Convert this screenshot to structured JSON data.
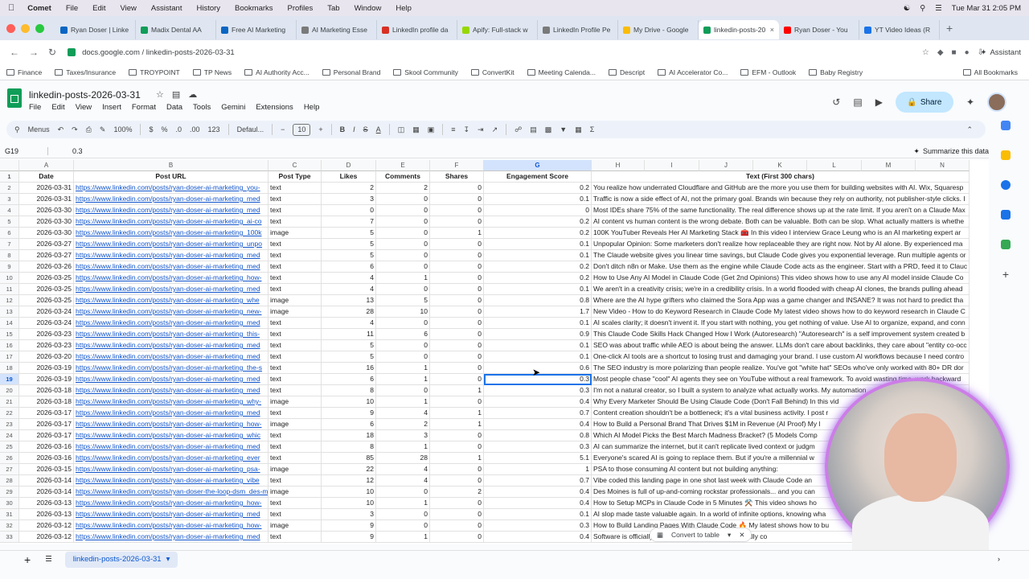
{
  "menubar": {
    "app": "Comet",
    "items": [
      "File",
      "Edit",
      "View",
      "Assistant",
      "History",
      "Bookmarks",
      "Profiles",
      "Tab",
      "Window",
      "Help"
    ],
    "datetime": "Tue Mar 31  2:05 PM"
  },
  "tabs": [
    {
      "label": "Ryan Doser | Linke",
      "color": "#0a66c2"
    },
    {
      "label": "Madix Dental AA",
      "color": "#0f9d58"
    },
    {
      "label": "Free AI Marketing",
      "color": "#0a66c2"
    },
    {
      "label": "AI Marketing Esse",
      "color": "#7a7a7a"
    },
    {
      "label": "LinkedIn profile da",
      "color": "#d93025"
    },
    {
      "label": "Apify: Full-stack w",
      "color": "#97d700"
    },
    {
      "label": "LinkedIn Profile Pe",
      "color": "#7a7a7a"
    },
    {
      "label": "My Drive - Google",
      "color": "#fbbc04"
    },
    {
      "label": "linkedin-posts-20",
      "color": "#0f9d58",
      "active": true
    },
    {
      "label": "Ryan Doser - You",
      "color": "#ff0000"
    },
    {
      "label": "YT Video Ideas (R",
      "color": "#1a73e8"
    }
  ],
  "address": {
    "url": "docs.google.com / linkedin-posts-2026-03-31",
    "assistant": "Assistant"
  },
  "bookmarks": [
    "Finance",
    "Taxes/Insurance",
    "TROYPOINT",
    "TP News",
    "AI Authority Acc...",
    "Personal Brand",
    "Skool Community",
    "ConvertKit",
    "Meeting Calenda...",
    "Descript",
    "AI Accelerator Co...",
    "EFM - Outlook",
    "Baby Registry"
  ],
  "all_bookmarks": "All Bookmarks",
  "sheet": {
    "title": "linkedin-posts-2026-03-31",
    "menus": [
      "File",
      "Edit",
      "View",
      "Insert",
      "Format",
      "Data",
      "Tools",
      "Gemini",
      "Extensions",
      "Help"
    ],
    "share": "Share",
    "toolbar": {
      "menus": "Menus",
      "zoom": "100%",
      "currency": "$",
      "percent": "%",
      "dec1": ".0",
      "dec2": ".00",
      "fmt": "123",
      "font": "Defaul...",
      "size": "10"
    },
    "namebox": "G19",
    "formula": "0.3",
    "summarize": "Summarize this data",
    "columns": [
      "A",
      "B",
      "C",
      "D",
      "E",
      "F",
      "G",
      "H",
      "I",
      "J",
      "K",
      "L",
      "M",
      "N"
    ],
    "headers": [
      "Date",
      "Post URL",
      "Post Type",
      "Likes",
      "Comments",
      "Shares",
      "Engagement Score",
      "Text (First 300 chars)"
    ],
    "rows": [
      [
        "2026-03-31",
        "https://www.linkedin.com/posts/ryan-doser-ai-marketing_you-",
        "text",
        "2",
        "2",
        "0",
        "0.2",
        "You realize how underrated Cloudflare and GitHub are the more you use them for building websites with AI.  Wix, Squaresp"
      ],
      [
        "2026-03-31",
        "https://www.linkedin.com/posts/ryan-doser-ai-marketing_med",
        "text",
        "3",
        "0",
        "0",
        "0.1",
        "Traffic is now a side effect of AI, not the primary goal. Brands win because they rely on authority, not publisher-style clicks. I"
      ],
      [
        "2026-03-30",
        "https://www.linkedin.com/posts/ryan-doser-ai-marketing_med",
        "text",
        "0",
        "0",
        "0",
        "0",
        "Most IDEs share 75% of the same functionality. The real difference shows up at the rate limit. If you aren't on a Claude Max"
      ],
      [
        "2026-03-30",
        "https://www.linkedin.com/posts/ryan-doser-ai-marketing_ai-co",
        "text",
        "7",
        "0",
        "0",
        "0.2",
        "AI content vs human content is the wrong debate.  Both can be valuable. Both can be slop.  What actually matters is whethe"
      ],
      [
        "2026-03-30",
        "https://www.linkedin.com/posts/ryan-doser-ai-marketing_100k",
        "image",
        "5",
        "0",
        "1",
        "0.2",
        "100K YouTuber Reveals Her AI Marketing Stack 🧰  In this video I interview Grace Leung who is an AI marketing expert ar"
      ],
      [
        "2026-03-27",
        "https://www.linkedin.com/posts/ryan-doser-ai-marketing_unpo",
        "text",
        "5",
        "0",
        "0",
        "0.1",
        "Unpopular Opinion: Some marketers don't realize how replaceable they are right now.  Not by AI alone. By experienced ma"
      ],
      [
        "2026-03-27",
        "https://www.linkedin.com/posts/ryan-doser-ai-marketing_med",
        "text",
        "5",
        "0",
        "0",
        "0.1",
        "The Claude website gives you linear time savings, but Claude Code gives you exponential leverage. Run multiple agents or"
      ],
      [
        "2026-03-26",
        "https://www.linkedin.com/posts/ryan-doser-ai-marketing_med",
        "text",
        "6",
        "0",
        "0",
        "0.2",
        "Don't ditch n8n or Make. Use them as the engine while Claude Code acts as the engineer. Start with a PRD, feed it to Clauc"
      ],
      [
        "2026-03-25",
        "https://www.linkedin.com/posts/ryan-doser-ai-marketing_how-",
        "text",
        "4",
        "1",
        "0",
        "0.2",
        "How to Use Any AI Model in Claude Code (Get 2nd Opinions)  This video shows how to use any AI model inside Claude Co"
      ],
      [
        "2026-03-25",
        "https://www.linkedin.com/posts/ryan-doser-ai-marketing_med",
        "text",
        "4",
        "0",
        "0",
        "0.1",
        "We aren't in a creativity crisis; we're in a credibility crisis. In a world flooded with cheap AI clones, the brands pulling ahead"
      ],
      [
        "2026-03-25",
        "https://www.linkedin.com/posts/ryan-doser-ai-marketing_whe",
        "image",
        "13",
        "5",
        "0",
        "0.8",
        "Where are the AI hype grifters who claimed the Sora App was a game changer and INSANE? It was not hard to predict tha"
      ],
      [
        "2026-03-24",
        "https://www.linkedin.com/posts/ryan-doser-ai-marketing_new-",
        "image",
        "28",
        "10",
        "0",
        "1.7",
        "New Video - How to do Keyword Research in Claude Code  My latest video shows how to do keyword research in Claude C"
      ],
      [
        "2026-03-24",
        "https://www.linkedin.com/posts/ryan-doser-ai-marketing_med",
        "text",
        "4",
        "0",
        "0",
        "0.1",
        "AI scales clarity; it doesn't invent it. If you start with nothing, you get nothing of value. Use AI to organize, expand, and conn"
      ],
      [
        "2026-03-23",
        "https://www.linkedin.com/posts/ryan-doser-ai-marketing_this-",
        "text",
        "11",
        "6",
        "0",
        "0.9",
        "This Claude Code Skills Hack Changed How I Work (Autoresearch)  \"Autoresearch\" is a self improvement system created b"
      ],
      [
        "2026-03-23",
        "https://www.linkedin.com/posts/ryan-doser-ai-marketing_med",
        "text",
        "5",
        "0",
        "0",
        "0.1",
        "SEO was about traffic while AEO is about being the answer. LLMs don't care about backlinks, they care about \"entity co-occ"
      ],
      [
        "2026-03-20",
        "https://www.linkedin.com/posts/ryan-doser-ai-marketing_med",
        "text",
        "5",
        "0",
        "0",
        "0.1",
        "One-click AI tools are a shortcut to losing trust and damaging your brand. I use custom AI workflows because I need contro"
      ],
      [
        "2026-03-19",
        "https://www.linkedin.com/posts/ryan-doser-ai-marketing_the-s",
        "text",
        "16",
        "1",
        "0",
        "0.6",
        "The SEO industry is more polarizing than people realize.  You've got \"white hat\" SEOs who've only worked with 80+ DR dor"
      ],
      [
        "2026-03-19",
        "https://www.linkedin.com/posts/ryan-doser-ai-marketing_med",
        "text",
        "6",
        "1",
        "0",
        "0.3",
        "Most people chase \"cool\" AI agents they see on YouTube without a real framework. To avoid wasting time, work backward"
      ],
      [
        "2026-03-18",
        "https://www.linkedin.com/posts/ryan-doser-ai-marketing_med",
        "text",
        "8",
        "0",
        "1",
        "0.3",
        "I'm not a natural creator, so I built a system to analyze what actually works. My automation"
      ],
      [
        "2026-03-18",
        "https://www.linkedin.com/posts/ryan-doser-ai-marketing_why-",
        "image",
        "10",
        "1",
        "0",
        "0.4",
        "Why Every Marketer Should Be Using Claude Code (Don't Fall Behind)  In this vid"
      ],
      [
        "2026-03-17",
        "https://www.linkedin.com/posts/ryan-doser-ai-marketing_med",
        "text",
        "9",
        "4",
        "1",
        "0.7",
        "Content creation shouldn't be a bottleneck; it's a vital business activity. I post r"
      ],
      [
        "2026-03-17",
        "https://www.linkedin.com/posts/ryan-doser-ai-marketing_how-",
        "image",
        "6",
        "2",
        "1",
        "0.4",
        "How to Build a Personal Brand That Drives $1M in Revenue (AI Proof)  My l"
      ],
      [
        "2026-03-17",
        "https://www.linkedin.com/posts/ryan-doser-ai-marketing_whic",
        "text",
        "18",
        "3",
        "0",
        "0.8",
        "Which AI Model Picks the Best March Madness Bracket? (5 Models Comp"
      ],
      [
        "2026-03-16",
        "https://www.linkedin.com/posts/ryan-doser-ai-marketing_med",
        "text",
        "8",
        "1",
        "0",
        "0.3",
        "AI can summarize the internet, but it can't replicate lived context or judgm"
      ],
      [
        "2026-03-16",
        "https://www.linkedin.com/posts/ryan-doser-ai-marketing_ever",
        "text",
        "85",
        "28",
        "1",
        "5.1",
        "Everyone's scared AI is going to replace them.  But if you're a millennial w"
      ],
      [
        "2026-03-15",
        "https://www.linkedin.com/posts/ryan-doser-ai-marketing_psa-",
        "image",
        "22",
        "4",
        "0",
        "1",
        "PSA to those consuming AI content but not building anything:"
      ],
      [
        "2026-03-14",
        "https://www.linkedin.com/posts/ryan-doser-ai-marketing_vibe",
        "text",
        "12",
        "4",
        "0",
        "0.7",
        "Vibe coded this landing page in one shot last week with Claude Code an"
      ],
      [
        "2026-03-14",
        "https://www.linkedin.com/posts/ryan-doser-the-loop-dsm_des-moines-is-l",
        "image",
        "10",
        "0",
        "2",
        "0.4",
        "Des Moines is full of up-and-coming rockstar professionals... and you can"
      ],
      [
        "2026-03-13",
        "https://www.linkedin.com/posts/ryan-doser-ai-marketing_how-",
        "text",
        "10",
        "1",
        "0",
        "0.4",
        "How to Setup MCPs in Claude Code in 5 Minutes ⚒️  This video shows ho"
      ],
      [
        "2026-03-13",
        "https://www.linkedin.com/posts/ryan-doser-ai-marketing_med",
        "text",
        "3",
        "0",
        "0",
        "0.1",
        "AI slop made taste valuable again. In a world of infinite options, knowing wha"
      ],
      [
        "2026-03-12",
        "https://www.linkedin.com/posts/ryan-doser-ai-marketing_how-",
        "image",
        "9",
        "0",
        "0",
        "0.3",
        "How to Build Landing Pages With Claude Code 🔥  My latest shows how to bu"
      ],
      [
        "2026-03-12",
        "https://www.linkedin.com/posts/ryan-doser-ai-marketing_med",
        "text",
        "9",
        "1",
        "0",
        "0.4",
        "Software is officially ... technical, AI slop will eventually co"
      ]
    ],
    "convert_pill": "Convert to table",
    "sheet_tab": "linkedin-posts-2026-03-31"
  }
}
